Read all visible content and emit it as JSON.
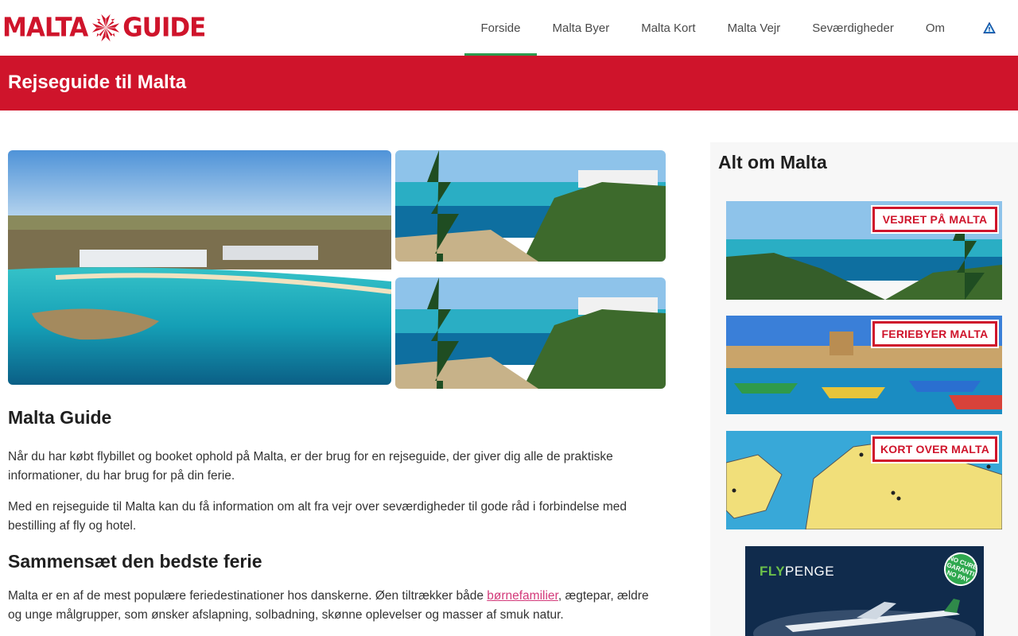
{
  "logo": {
    "left": "MALTA",
    "right": "GUIDE"
  },
  "nav": [
    {
      "label": "Forside",
      "active": true
    },
    {
      "label": "Malta Byer"
    },
    {
      "label": "Malta Kort"
    },
    {
      "label": "Malta Vejr"
    },
    {
      "label": "Seværdigheder"
    },
    {
      "label": "Om"
    }
  ],
  "nav_icon": "warning-triangle-icon",
  "banner": {
    "title": "Rejseguide til Malta"
  },
  "main": {
    "heading1": "Malta Guide",
    "para1": "Når du har købt flybillet og booket ophold på Malta, er der brug for en rejseguide, der giver dig alle de praktiske informationer, du har brug for på din ferie.",
    "para2": "Med en rejseguide til Malta kan du få information om alt fra vejr over seværdigheder til gode råd i forbindelse med bestilling af fly og hotel.",
    "heading2": "Sammensæt den bedste ferie",
    "para3_before": "Malta er en af de mest populære feriedestinationer hos danskerne. Øen tiltrækker både ",
    "para3_link": "børnefamilier",
    "para3_after": ", ægtepar, ældre og unge målgrupper, som ønsker afslapning, solbadning, skønne oplevelser og masser af smuk natur."
  },
  "sidebar": {
    "title": "Alt om Malta",
    "cards": [
      {
        "label": "VEJRET PÅ MALTA"
      },
      {
        "label": "FERIEBYER MALTA"
      },
      {
        "label": "KORT OVER MALTA"
      }
    ],
    "ad": {
      "brand_prefix": "FLY",
      "brand_suffix": "PENGE",
      "badge": "NO CURE GARANTI NO PAY"
    }
  },
  "colors": {
    "brand_red": "#cf142b",
    "nav_active": "#2e9a4f",
    "link": "#d33a7a"
  }
}
